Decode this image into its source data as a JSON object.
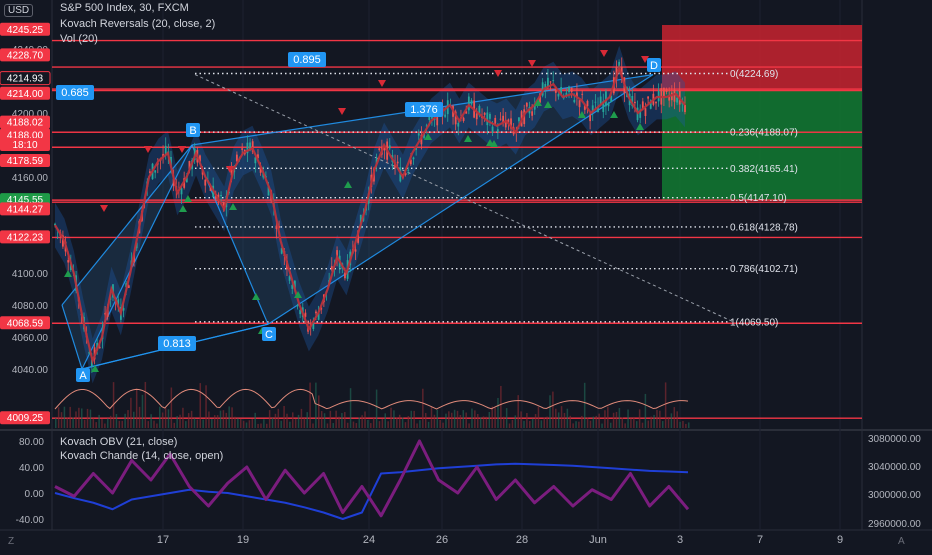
{
  "header": {
    "currency": "USD",
    "title": "S&P 500 Index, 30, FXCM",
    "indicator_1": "Kovach Reversals (20, close, 2)",
    "indicator_2": "Vol (20)",
    "lower_indicator_1": "Kovach OBV (21, close)",
    "lower_indicator_2": "Kovach Chande (14, close, open)"
  },
  "colors": {
    "background": "#131722",
    "candle_up": "#26a69a",
    "candle_down": "#ef5350",
    "hline": "#f23645",
    "price_tag_red": "#f23645",
    "price_tag_green": "#1e9b47",
    "pattern_line": "#2196f3",
    "ma_line": "#b8323b",
    "band_fill": "#1e5aa8",
    "obv_line": "#1f3fd6",
    "chande_line": "#7b1d7e",
    "label_bg": "#2196f3"
  },
  "chart_data": [
    {
      "type": "line",
      "title": "S&P 500 Index, 30, FXCM",
      "x_axis": {
        "tick_labels": [
          "17",
          "19",
          "24",
          "26",
          "28",
          "Jun",
          "3",
          "7",
          "9"
        ]
      },
      "y_axis": {
        "range": [
          4000,
          4260
        ],
        "tick_labels": [
          "4040.00",
          "4060.00",
          "4080.00",
          "4100.00",
          "4160.00",
          "4200.00",
          "4240.00"
        ]
      },
      "series": [
        {
          "values": [
            4130,
            4120,
            4100,
            4070,
            4045,
            4060,
            4090,
            4075,
            4100,
            4130,
            4160,
            4170,
            4175,
            4150,
            4160,
            4175,
            4160,
            4150,
            4140,
            4165,
            4175,
            4178,
            4165,
            4150,
            4120,
            4100,
            4080,
            4065,
            4075,
            4090,
            4110,
            4100,
            4120,
            4140,
            4165,
            4180,
            4170,
            4160,
            4175,
            4185,
            4195,
            4200,
            4205,
            4195,
            4205,
            4200,
            4195,
            4192,
            4195,
            4188,
            4200,
            4205,
            4215,
            4218,
            4210,
            4212,
            4208,
            4200,
            4205,
            4210,
            4228,
            4210,
            4200,
            4205,
            4210,
            4210,
            4212,
            4205
          ]
        }
      ],
      "horizontal_levels": [
        "4245.25",
        "4228.70",
        "4214.93",
        "4214.00",
        "4188.02",
        "4188.00",
        "4178.59",
        "4145.55",
        "4144.27",
        "4122.23",
        "4068.59",
        "4009.25"
      ],
      "price_tags": [
        {
          "text": "4245.25",
          "style": "red"
        },
        {
          "text": "4228.70",
          "style": "red"
        },
        {
          "text": "4214.93",
          "style": "outline"
        },
        {
          "text": "4214.00",
          "style": "red"
        },
        {
          "text": "4188.02",
          "style": "red"
        },
        {
          "text": "4188.00",
          "style": "red"
        },
        {
          "text": "18:10",
          "style": "red"
        },
        {
          "text": "4178.59",
          "style": "red"
        },
        {
          "text": "4145.55",
          "style": "green"
        },
        {
          "text": "4144.27",
          "style": "red"
        },
        {
          "text": "4122.23",
          "style": "red"
        },
        {
          "text": "4068.59",
          "style": "red"
        },
        {
          "text": "4009.25",
          "style": "red"
        }
      ],
      "fibonacci": [
        {
          "label": "0(4224.69)",
          "level": 0,
          "price": 4224.69
        },
        {
          "label": "0.236(4188.07)",
          "level": 0.236,
          "price": 4188.07
        },
        {
          "label": "0.382(4165.41)",
          "level": 0.382,
          "price": 4165.41
        },
        {
          "label": "0.5(4147.10)",
          "level": 0.5,
          "price": 4147.1
        },
        {
          "label": "0.618(4128.78)",
          "level": 0.618,
          "price": 4128.78
        },
        {
          "label": "0.786(4102.71)",
          "level": 0.786,
          "price": 4102.71
        },
        {
          "label": "1(4069.50)",
          "level": 1,
          "price": 4069.5
        }
      ],
      "pattern_points": [
        "A",
        "B",
        "C",
        "D"
      ],
      "pattern_ratios": [
        "0.685",
        "0.813",
        "1.376",
        "0.895"
      ]
    },
    {
      "type": "line",
      "title": "Kovach OBV (21, close)",
      "x_axis": {
        "tick_labels": [
          "17",
          "19",
          "24",
          "26",
          "28",
          "Jun",
          "3",
          "7",
          "9"
        ]
      },
      "y_axis_left": {
        "tick_labels": [
          "80.00",
          "40.00",
          "0.00",
          "-40.00"
        ]
      },
      "y_axis_right": {
        "tick_labels": [
          "3080000.00",
          "3040000.00",
          "3000000.00",
          "2960000.00"
        ]
      },
      "series": [
        {
          "name": "Kovach OBV (21, close)",
          "values": [
            0,
            -8,
            -15,
            -25,
            -10,
            -5,
            0,
            5,
            2,
            0,
            -5,
            -10,
            -15,
            -22,
            -30,
            -40,
            -30,
            30,
            32,
            35,
            38,
            40,
            42,
            44,
            45,
            44,
            43,
            42,
            40,
            38,
            36,
            34,
            33,
            32
          ]
        },
        {
          "name": "Kovach Chande (14, close, open)",
          "values": [
            10,
            -5,
            30,
            0,
            50,
            20,
            60,
            10,
            -20,
            15,
            40,
            -10,
            35,
            0,
            30,
            -30,
            10,
            -35,
            20,
            80,
            20,
            0,
            40,
            -10,
            20,
            -15,
            10,
            -20,
            5,
            -10,
            30,
            -20,
            10,
            -25
          ]
        }
      ]
    }
  ],
  "footer": {
    "left_icon": "Z",
    "right_icon": "A"
  }
}
